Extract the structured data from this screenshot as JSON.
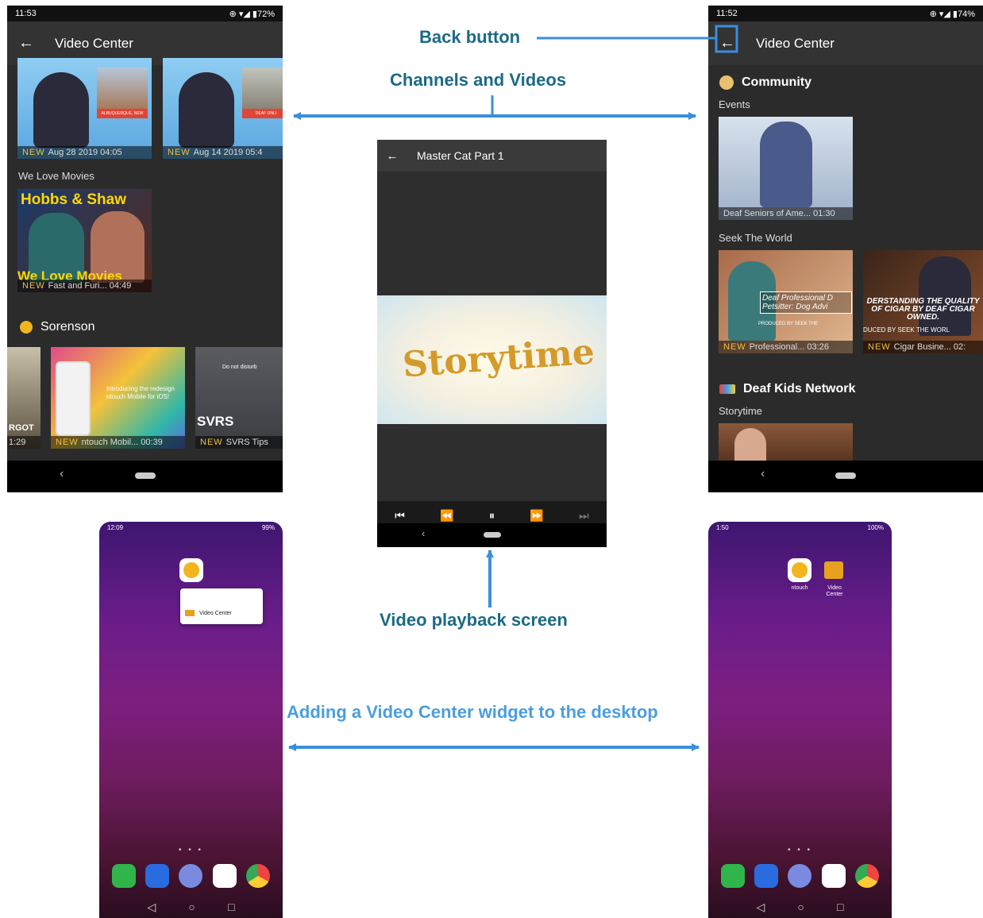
{
  "callouts": {
    "back_button": "Back button",
    "channels_videos": "Channels and Videos",
    "playback_screen": "Video playback screen",
    "widget": "Adding a Video Center widget to the desktop"
  },
  "screen_left": {
    "time": "11:53",
    "status_icons": "⊕ ▾◢ ▮72%",
    "title": "Video Center",
    "top_videos": [
      {
        "overlay": "ALBUQUERQUE, NEW",
        "new": "NEW",
        "meta": "Aug 28 2019   04:05"
      },
      {
        "overlay": "DEAF ONLI",
        "new": "NEW",
        "meta": "Aug 14 2019   05:4"
      }
    ],
    "section_movies": "We Love Movies",
    "movie": {
      "poster_title": "Hobbs & Shaw",
      "overlay": "We Love Movies",
      "new": "NEW",
      "meta": "Fast and Furi... 04:49"
    },
    "channel": "Sorenson",
    "sorenson_videos": [
      {
        "overlay": "RGOT",
        "meta": "1:29"
      },
      {
        "overlay": "Introducing the redesign ntouch Mobile for iOS!",
        "new": "NEW",
        "meta": "ntouch Mobil... 00:39"
      },
      {
        "overlay": "SVRS",
        "top": "Do not disturb",
        "new": "NEW",
        "meta": "SVRS Tips"
      }
    ]
  },
  "screen_center": {
    "title": "Master Cat Part 1",
    "video_text": "Storytime",
    "controls": [
      "skip-previous",
      "rewind",
      "pause",
      "fast-forward",
      "skip-next"
    ]
  },
  "screen_right": {
    "time": "11:52",
    "status_icons": "⊕ ▾◢ ▮74%",
    "title": "Video Center",
    "channel_community": "Community",
    "section_events": "Events",
    "events_video": {
      "meta": "Deaf Seniors of Ame... 01:30"
    },
    "section_seek": "Seek The World",
    "seek_videos": [
      {
        "overlay": "Deaf Professional D Petsitter: Dog Advi",
        "sub": "PRODUCED BY SEEK THE",
        "new": "NEW",
        "meta": "Professional... 03:26"
      },
      {
        "overlay": "DERSTANDING THE QUALITY OF CIGAR BY DEAF CIGAR OWNED.",
        "sub": "DUCED BY SEEK THE WORL",
        "new": "NEW",
        "meta": "Cigar Busine... 02:"
      }
    ],
    "channel_kids": "Deaf Kids Network",
    "section_storytime": "Storytime"
  },
  "home_left": {
    "time": "12:09",
    "battery": "99%",
    "popup_item": "Video Center",
    "dots": "• • •"
  },
  "home_right": {
    "time": "1:50",
    "battery": "100%",
    "app1": "ntouch",
    "app2": "Video Center",
    "dots": "• • •"
  },
  "colors": {
    "callout_dark": "#1b6a86",
    "callout_light": "#4a9ee0",
    "arrow": "#3a8fdc"
  }
}
